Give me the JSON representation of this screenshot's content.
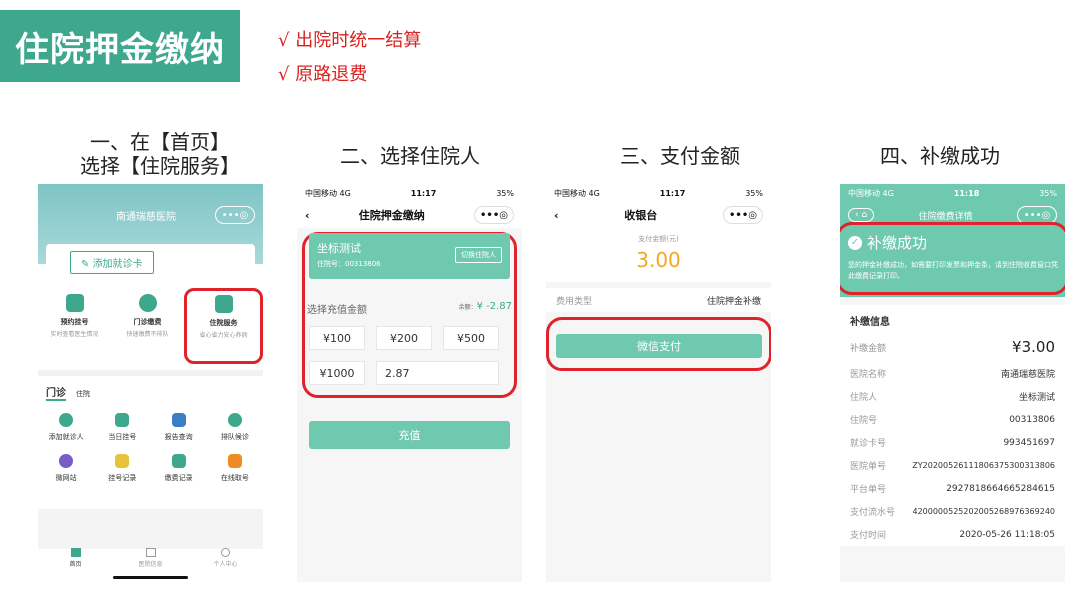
{
  "title": "住院押金缴纳",
  "features": [
    "√ 出院时统一结算",
    "√ 原路退费"
  ],
  "steps": {
    "s1a": "一、在【首页】",
    "s1b": "选择【住院服务】",
    "s2": "二、选择住院人",
    "s3": "三、支付金额",
    "s4": "四、补缴成功"
  },
  "colors": {
    "accent": "#3ea88f",
    "highlight": "#e0232a",
    "button": "#6fc9ae"
  },
  "p1": {
    "hospital": "南通瑞慈医院",
    "add_card": "添加就诊卡",
    "services": [
      {
        "title": "预约挂号",
        "sub": "实时查看医生情况"
      },
      {
        "title": "门诊缴费",
        "sub": "快速缴费不排队"
      },
      {
        "title": "住院服务",
        "sub": "省心省力安心养病"
      }
    ],
    "tab_outpatient": "门诊",
    "tab_inpatient": "住院",
    "grid": [
      "添加就诊人",
      "当日挂号",
      "报告查询",
      "排队候诊",
      "微网站",
      "挂号记录",
      "缴费记录",
      "在线取号"
    ],
    "bottom": [
      "首页",
      "医院信息",
      "个人中心"
    ]
  },
  "p2": {
    "carrier": "中国移动 4G",
    "time": "11:17",
    "battery": "35%",
    "title": "住院押金缴纳",
    "patient": "坐标测试",
    "inpatient_no": "住院号：00313806",
    "switch": "切换住院人",
    "choose": "选择充值金额",
    "balance_label": "余额：",
    "balance": "¥ -2.87",
    "amounts": [
      "¥100",
      "¥200",
      "¥500",
      "¥1000"
    ],
    "custom": "2.87",
    "submit": "充值"
  },
  "p3": {
    "carrier": "中国移动 4G",
    "time": "11:17",
    "battery": "35%",
    "title": "收银台",
    "amount_label": "支付金额(元)",
    "amount": "3.00",
    "fee_type_label": "费用类型",
    "fee_type": "住院押金补缴",
    "pay": "微信支付"
  },
  "p4": {
    "carrier": "中国移动 4G",
    "time": "11:18",
    "battery": "35%",
    "title": "住院缴费详情",
    "success": "补缴成功",
    "msg": "您的押金补缴成功，如需要打印发票和押金条，请到住院收费窗口凭此缴费记录打印。",
    "section": "补缴信息",
    "amount_label": "补缴金额",
    "amount": "¥3.00",
    "rows": [
      [
        "医院名称",
        "南通瑞慈医院"
      ],
      [
        "住院人",
        "坐标测试"
      ],
      [
        "住院号",
        "00313806"
      ],
      [
        "就诊卡号",
        "993451697"
      ],
      [
        "医院单号",
        "ZY20200526111806375300313806"
      ],
      [
        "平台单号",
        "2927818664665284615"
      ],
      [
        "支付流水号",
        "4200000525202005268976369240"
      ],
      [
        "支付时间",
        "2020-05-26 11:18:05"
      ]
    ]
  }
}
